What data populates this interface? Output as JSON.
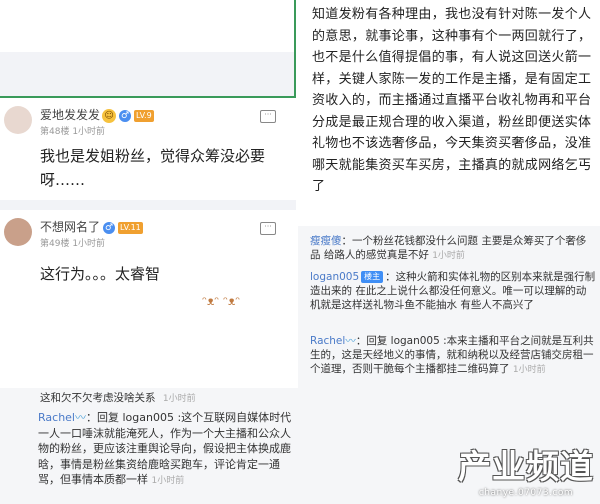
{
  "colors": {
    "accent": "#4a7ac8",
    "level_badge": "#f0a030",
    "owner_badge": "#3f8ef5"
  },
  "posts": [
    {
      "user": "爱地发发发",
      "emoji": "smiling-face-emoji",
      "gender": "♂",
      "level": "LV.9",
      "floor": "第48楼",
      "time": "1小时前",
      "text": "我也是发姐粉丝，觉得众筹没必要呀……",
      "reply_icon": "comment-icon"
    },
    {
      "user": "不想网名了",
      "gender": "♂",
      "level": "LV.11",
      "floor": "第49楼",
      "time": "1小时前",
      "text": "这行为。。。太睿智",
      "reply_icon": "comment-icon"
    }
  ],
  "main_text": "知道发粉有各种理由，我也没有针对陈一发个人的意思，就事论事，这种事有个一两回就行了，也不是什么值得提倡的事，有人说这回送火箭一样，关键人家陈一发的工作是主播，是有固定工资收入的，而主播通过直播平台收礼物再和平台分成是最正规合理的收入渠道，粉丝即便送实体礼物也不该选奢侈品，今天集资买奢侈品，没准哪天就能集资买车买房，主播真的就成网络乞丐了",
  "comments": [
    {
      "name": "瘦瘦傻",
      "text": "一个粉丝花钱都没什么问题 主要是众筹买了个奢侈品 给路人的感觉真是不好",
      "time": "1小时前"
    },
    {
      "name": "logan005",
      "badge": "楼主",
      "text": "这种火箭和实体礼物的区别本来就是强行制造出来的 在此之上说什么都没任何意义。唯一可以理解的动机就是这样送礼物斗鱼不能抽水 有些人不高兴了",
      "time": ""
    },
    {
      "name": "Rachel",
      "text": "回复 logan005 :本来主播和平台之间就是互利共生的，这是天经地义的事情，就和纳税以及经营店铺交房租一个道理，否则干脆每个主播都挂二维码算了",
      "time": "1小时前"
    }
  ],
  "bottom": {
    "fragment": "这和欠不欠考虑没啥关系",
    "fragment_time": "1小时前",
    "name": "Rachel",
    "text": "回复 logan005 :这个互联网自媒体时代一人一口唾沫就能淹死人，作为一个大主播和公众人物的粉丝，更应该注重舆论导向，假设把主体换成鹿晗，事情是粉丝集资给鹿晗买跑车，评论肯定一通骂，但事情本质都一样",
    "time": "1小时前"
  },
  "watermark": {
    "big": "产业频道",
    "small": "chanye.07073.com"
  }
}
